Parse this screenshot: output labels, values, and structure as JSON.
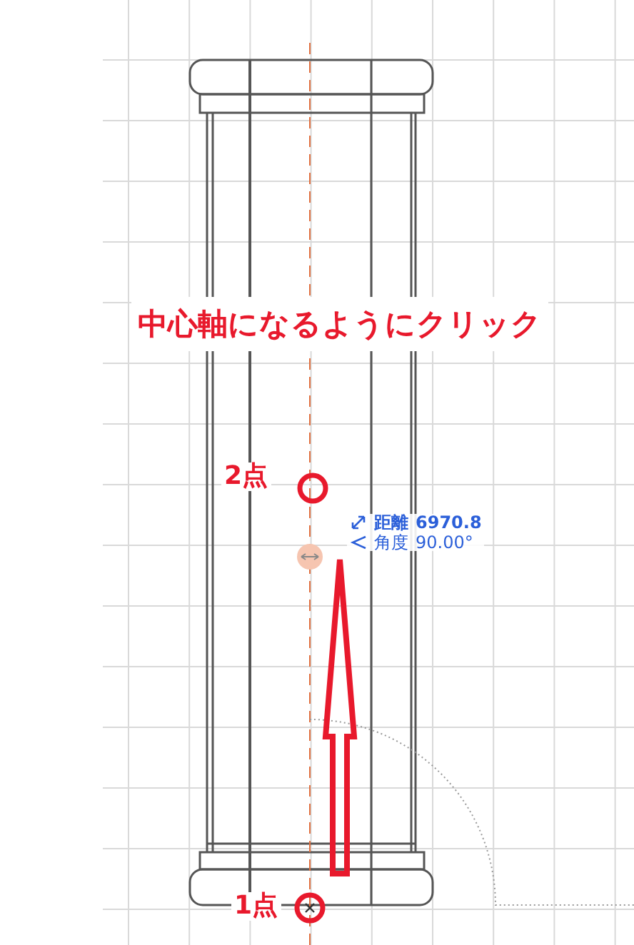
{
  "instruction": "中心軸になるようにクリック",
  "points": [
    {
      "label": "2点"
    },
    {
      "label": "1点"
    }
  ],
  "tooltip": [
    {
      "kind": "distance",
      "label": "距離",
      "value": "6970.8"
    },
    {
      "kind": "angle",
      "label": "角度",
      "value": "90.00°"
    }
  ]
}
